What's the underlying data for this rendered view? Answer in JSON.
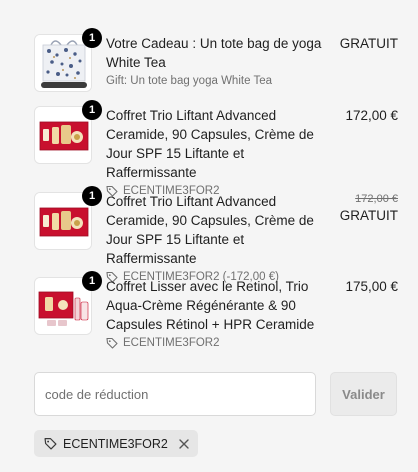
{
  "items": [
    {
      "quantity": "1",
      "name": "Votre Cadeau : Un tote bag de yoga White Tea",
      "subtitle": "Gift: Un tote bag yoga White Tea",
      "price": "GRATUIT",
      "image": "tote-bag"
    },
    {
      "quantity": "1",
      "name": "Coffret Trio Liftant Advanced Ceramide, 90 Capsules, Crème de Jour SPF 15 Liftante et Raffermissante",
      "discount_code": "ECENTIME3FOR2",
      "price": "172,00 €",
      "image": "red-gift-box"
    },
    {
      "quantity": "1",
      "name": "Coffret Trio Liftant Advanced Ceramide, 90 Capsules, Crème de Jour SPF 15 Liftante et Raffermissante",
      "discount_code": "ECENTIME3FOR2 (-172,00 €)",
      "original_price": "172,00 €",
      "price": "GRATUIT",
      "image": "red-gift-box"
    },
    {
      "quantity": "1",
      "name": "Coffret Lisser avec le Retinol, Trio Aqua-Crème Régénérante & 90 Capsules Rétinol + HPR Ceramide",
      "discount_code": "ECENTIME3FOR2",
      "price": "175,00 €",
      "image": "retinol-gift-box"
    }
  ],
  "discount": {
    "placeholder": "code de réduction",
    "value": "",
    "validate_label": "Valider",
    "applied_code": "ECENTIME3FOR2"
  },
  "icons": {
    "tag": "tag-icon",
    "close": "close-icon"
  },
  "colors": {
    "badge": "#000000",
    "gift_box_red": "#c8102e",
    "gold": "#c9a24a"
  }
}
